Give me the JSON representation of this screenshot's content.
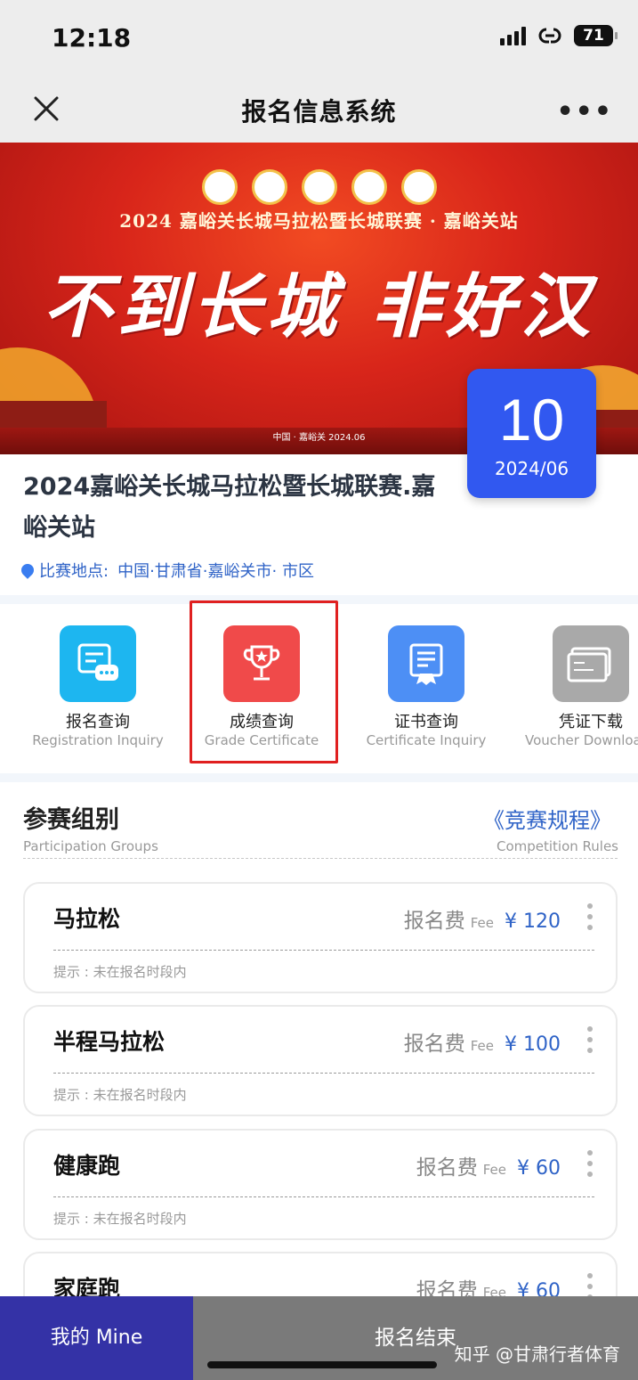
{
  "status_bar": {
    "time": "12:18",
    "battery": "71"
  },
  "nav": {
    "title": "报名信息系统",
    "more": "•••"
  },
  "banner": {
    "title": "2024 嘉峪关长城马拉松暨长城联赛 · 嘉峪关站",
    "slogan": "不到长城 非好汉",
    "sub": "中国 · 嘉峪关 2024.06"
  },
  "date_badge": {
    "day": "10",
    "month": "2024/06"
  },
  "event": {
    "title": "2024嘉峪关长城马拉松暨长城联赛.嘉峪关站",
    "location_label": "比赛地点:",
    "location_value": "中国·甘肃省·嘉峪关市· 市区"
  },
  "menu": [
    {
      "label": "报名查询",
      "sub": "Registration Inquiry",
      "icon": "chat-icon",
      "color": "#1db6f0"
    },
    {
      "label": "成绩查询",
      "sub": "Grade Certificate",
      "icon": "trophy-icon",
      "color": "#f04a4a"
    },
    {
      "label": "证书查询",
      "sub": "Certificate Inquiry",
      "icon": "certificate-icon",
      "color": "#4d8ff5"
    },
    {
      "label": "凭证下载",
      "sub": "Voucher Download",
      "icon": "ticket-icon",
      "color": "#a9a9a9"
    }
  ],
  "groups": {
    "title": "参赛组别",
    "sub": "Participation Groups",
    "rules_link": "《竞赛规程》",
    "rules_sub": "Competition Rules"
  },
  "cards": [
    {
      "name": "马拉松",
      "fee_label": "报名费",
      "fee_en": "Fee",
      "price": "¥ 120",
      "tip": "提示 : 未在报名时段内"
    },
    {
      "name": "半程马拉松",
      "fee_label": "报名费",
      "fee_en": "Fee",
      "price": "¥ 100",
      "tip": "提示 : 未在报名时段内"
    },
    {
      "name": "健康跑",
      "fee_label": "报名费",
      "fee_en": "Fee",
      "price": "¥ 60",
      "tip": "提示 : 未在报名时段内"
    },
    {
      "name": "家庭跑",
      "fee_label": "报名费",
      "fee_en": "Fee",
      "price": "¥ 60",
      "tip": ""
    }
  ],
  "bottom": {
    "mine": "我的 Mine",
    "closed": "报名结束",
    "watermark": "知乎 @甘肃行者体育"
  },
  "colors": {
    "accent": "#3158f0",
    "link": "#2f63c7",
    "highlight": "#e02020"
  }
}
